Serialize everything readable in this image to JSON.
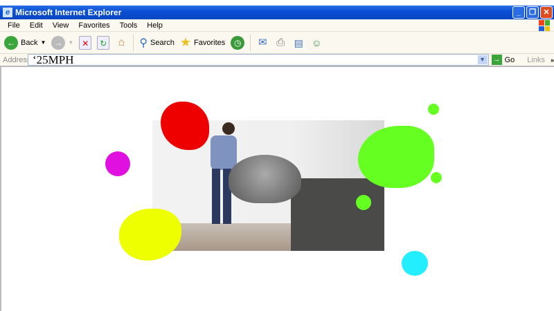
{
  "window": {
    "title": "Microsoft Internet Explorer",
    "minimize": "_",
    "restore": "❐",
    "close": "✕"
  },
  "menu": [
    "File",
    "Edit",
    "View",
    "Favorites",
    "Tools",
    "Help"
  ],
  "toolbar": {
    "back": "Back",
    "search": "Search",
    "favorites": "Favorites"
  },
  "address": {
    "label": "Address",
    "value": "‘25MPH",
    "go": "Go",
    "links": "Links",
    "more": "»"
  },
  "colors": {
    "red": "#ee0000",
    "magenta": "#e010e0",
    "yellow": "#eeff00",
    "green": "#66ff22",
    "cyan": "#22eeff"
  }
}
